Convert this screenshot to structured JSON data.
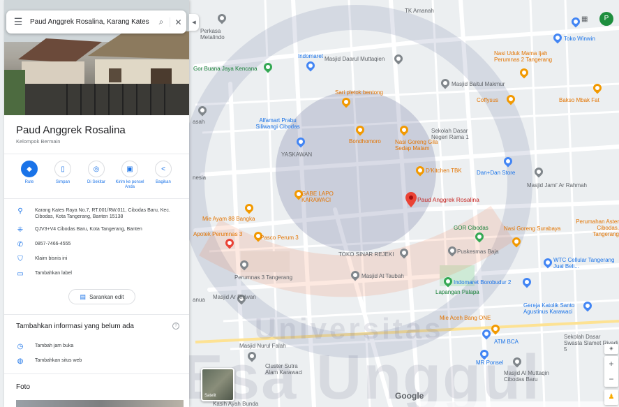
{
  "search": {
    "query": "Paud Anggrek Rosalina, Karang Kates"
  },
  "place": {
    "title": "Paud Anggrek Rosalina",
    "category": "Kelompok Bermain",
    "actions": [
      {
        "label": "Rute",
        "icon": "directions-icon"
      },
      {
        "label": "Simpan",
        "icon": "bookmark-icon"
      },
      {
        "label": "Di Sekitar",
        "icon": "nearby-icon"
      },
      {
        "label": "Kirim ke ponsel Anda",
        "icon": "send-to-phone-icon"
      },
      {
        "label": "Bagikan",
        "icon": "share-icon"
      }
    ],
    "address": "Karang Kates Raya No.7, RT.001/RW.011, Cibodas Baru, Kec. Cibodas, Kota Tangerang, Banten 15138",
    "plus_code": "QJV3+V4 Cibodas Baru, Kota Tangerang, Banten",
    "phone": "0857-7466-4555",
    "claim": "Klaim bisnis ini",
    "add_label": "Tambahkan label",
    "suggest_edit": "Sarankan edit",
    "missing_info_heading": "Tambahkan informasi yang belum ada",
    "add_hours": "Tambah jam buka",
    "add_website": "Tambahkan situs web",
    "photos_heading": "Foto"
  },
  "map": {
    "satellite_label": "Satelit",
    "labels": [
      {
        "text": "TK Amanah",
        "cls": "dark"
      },
      {
        "text": "Perkasa Metalindo",
        "cls": "dark"
      },
      {
        "text": "Indomaret",
        "cls": "blue"
      },
      {
        "text": "Masjid Daarul Muttaqien",
        "cls": "dark"
      },
      {
        "text": "Nasi Uduk Mama Ijah Perumnas 2 Tangerang",
        "cls": "orange"
      },
      {
        "text": "Toko Winwin",
        "cls": "blue"
      },
      {
        "text": "Gor Buana Jaya Kencana",
        "cls": "green"
      },
      {
        "text": "Masjid Baitul Makmur",
        "cls": "dark"
      },
      {
        "text": "Coffysus",
        "cls": "orange"
      },
      {
        "text": "Bakso Mbak Fat",
        "cls": "orange"
      },
      {
        "text": "Sari pletok bentong",
        "cls": "orange"
      },
      {
        "text": "Alfamart Prabu Siliwangi Cibodas",
        "cls": "blue"
      },
      {
        "text": "Sekolah Dasar Negeri Rama 1",
        "cls": "dark"
      },
      {
        "text": "Bondhomoro",
        "cls": "orange"
      },
      {
        "text": "Nasi Goreng Gila Sedap Malam",
        "cls": "orange"
      },
      {
        "text": "YASKAWAN",
        "cls": "dark"
      },
      {
        "text": "D'Kitchen TBK",
        "cls": "orange"
      },
      {
        "text": "Dan+Dan Store",
        "cls": "blue"
      },
      {
        "text": "Masjid Jami' Ar Rahmah",
        "cls": "dark"
      },
      {
        "text": "GABE LAPO KARAWACI",
        "cls": "orange"
      },
      {
        "text": "Paud Anggrek Rosalina",
        "cls": "red"
      },
      {
        "text": "Mie Ayam 88 Bangka",
        "cls": "orange"
      },
      {
        "text": "Perumahan Aster Cibodas, Tangerang",
        "cls": "orange"
      },
      {
        "text": "GOR Cibodas",
        "cls": "green"
      },
      {
        "text": "Nasi Goreng Surabaya",
        "cls": "orange"
      },
      {
        "text": "Apotek Perumnas 3",
        "cls": "orange"
      },
      {
        "text": "Pasco Perum 3",
        "cls": "orange"
      },
      {
        "text": "Puskesmas Baja",
        "cls": "dark"
      },
      {
        "text": "TOKO SINAR REJEKI",
        "cls": "dark"
      },
      {
        "text": "WTC Cellular Tangerang Jual Beli...",
        "cls": "blue"
      },
      {
        "text": "Perumnas 3 Tangerang",
        "cls": "dark"
      },
      {
        "text": "Masjid At Taubah",
        "cls": "dark"
      },
      {
        "text": "Indomaret Borobudur 2",
        "cls": "blue"
      },
      {
        "text": "Lapangan Palapa",
        "cls": "green"
      },
      {
        "text": "Gereja Katolik Santo Agustinus Karawaci",
        "cls": "blue"
      },
      {
        "text": "Masjid Ar Ridwan",
        "cls": "dark"
      },
      {
        "text": "Mie Aceh Bang ONE",
        "cls": "orange"
      },
      {
        "text": "ATM BCA",
        "cls": "blue"
      },
      {
        "text": "Sekolah Dasar Swasta Slamet Riyadi 5",
        "cls": "dark"
      },
      {
        "text": "Masjid Nurul Falah",
        "cls": "dark"
      },
      {
        "text": "Cluster Sutra Alam Karawaci",
        "cls": "dark"
      },
      {
        "text": "MR Ponsel",
        "cls": "blue"
      },
      {
        "text": "Masjid Al Muttaqin Cibodas Baru",
        "cls": "dark"
      },
      {
        "text": "Kasih Ayah Bunda",
        "cls": "dark"
      },
      {
        "text": "asah",
        "cls": "dark"
      },
      {
        "text": "nesia",
        "cls": "dark"
      },
      {
        "text": "anua",
        "cls": "dark"
      }
    ],
    "watermark_top": "Universitas",
    "watermark_bottom": "Esa Unggul",
    "google_logo": "Google"
  },
  "user": {
    "avatar_letter": "P"
  },
  "colors": {
    "accent": "#1a73e8",
    "pin_red": "#ea4335"
  }
}
